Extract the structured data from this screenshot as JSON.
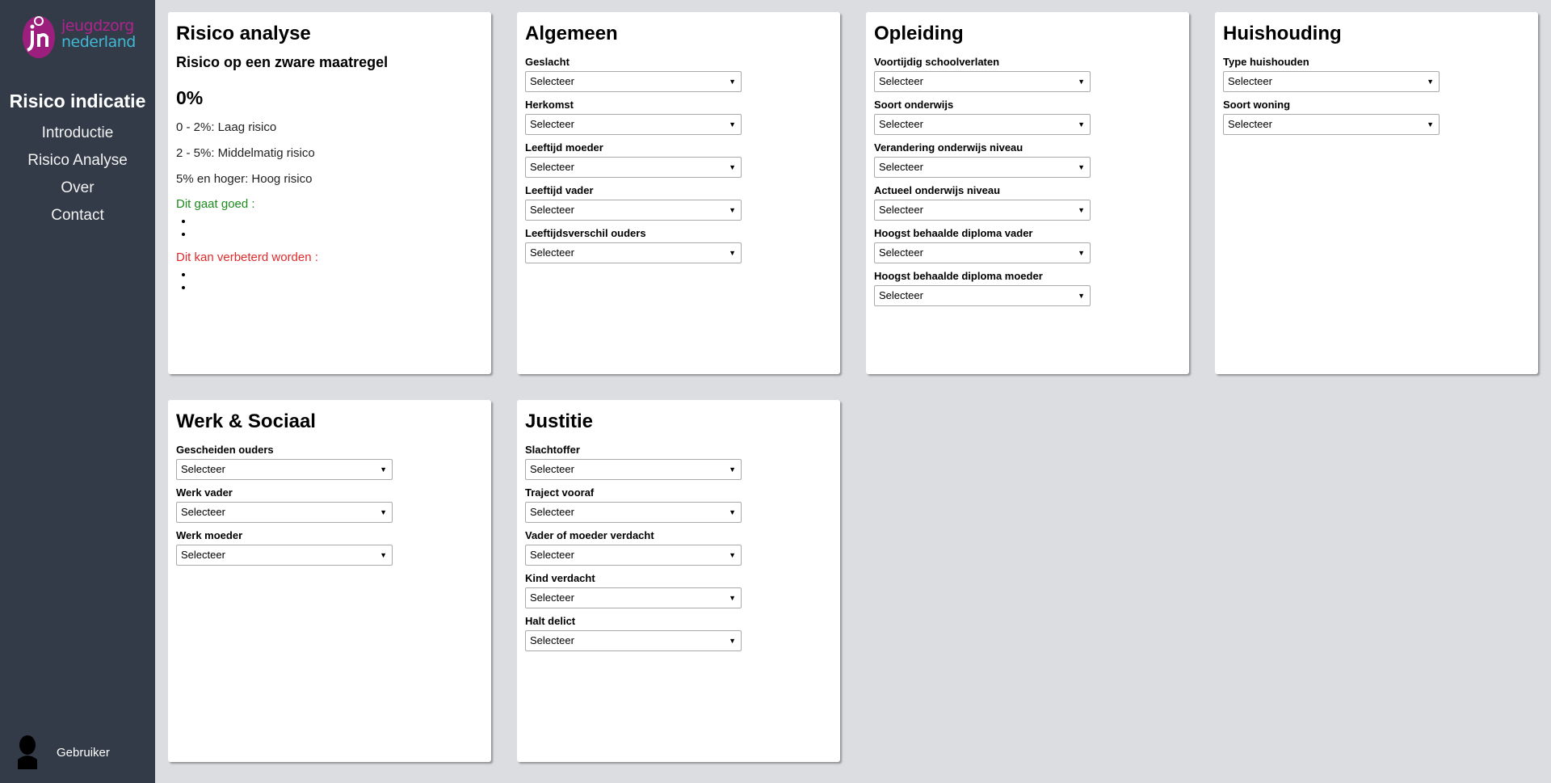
{
  "sidebar": {
    "logo_line1": "jeugdzorg",
    "logo_line2": "nederland",
    "title": "Risico indicatie",
    "nav": [
      "Introductie",
      "Risico Analyse",
      "Over",
      "Contact"
    ],
    "user": "Gebruiker"
  },
  "risk": {
    "title": "Risico analyse",
    "subtitle": "Risico op een zware maatregel",
    "percent": "0%",
    "levels": [
      "0 - 2%: Laag risico",
      "2 - 5%: Middelmatig risico",
      "5% en hoger: Hoog risico"
    ],
    "good_label": "Dit gaat goed :",
    "bad_label": "Dit kan verbeterd worden :"
  },
  "select_placeholder": "Selecteer",
  "cards": {
    "algemeen": {
      "title": "Algemeen",
      "fields": [
        "Geslacht",
        "Herkomst",
        "Leeftijd moeder",
        "Leeftijd vader",
        "Leeftijdsverschil ouders"
      ]
    },
    "opleiding": {
      "title": "Opleiding",
      "fields": [
        "Voortijdig schoolverlaten",
        "Soort onderwijs",
        "Verandering onderwijs niveau",
        "Actueel onderwijs niveau",
        "Hoogst behaalde diploma vader",
        "Hoogst behaalde diploma moeder"
      ]
    },
    "huishouding": {
      "title": "Huishouding",
      "fields": [
        "Type huishouden",
        "Soort woning"
      ]
    },
    "werk": {
      "title": "Werk & Sociaal",
      "fields": [
        "Gescheiden ouders",
        "Werk vader",
        "Werk moeder"
      ]
    },
    "justitie": {
      "title": "Justitie",
      "fields": [
        "Slachtoffer",
        "Traject vooraf",
        "Vader of moeder verdacht",
        "Kind verdacht",
        "Halt delict"
      ]
    }
  },
  "colors": {
    "sidebar": "#333b48",
    "background": "#dcdde1",
    "good": "#1d8a1d",
    "bad": "#e12a2a",
    "logo_magenta": "#b1238f",
    "logo_cyan": "#3fb8d3"
  }
}
